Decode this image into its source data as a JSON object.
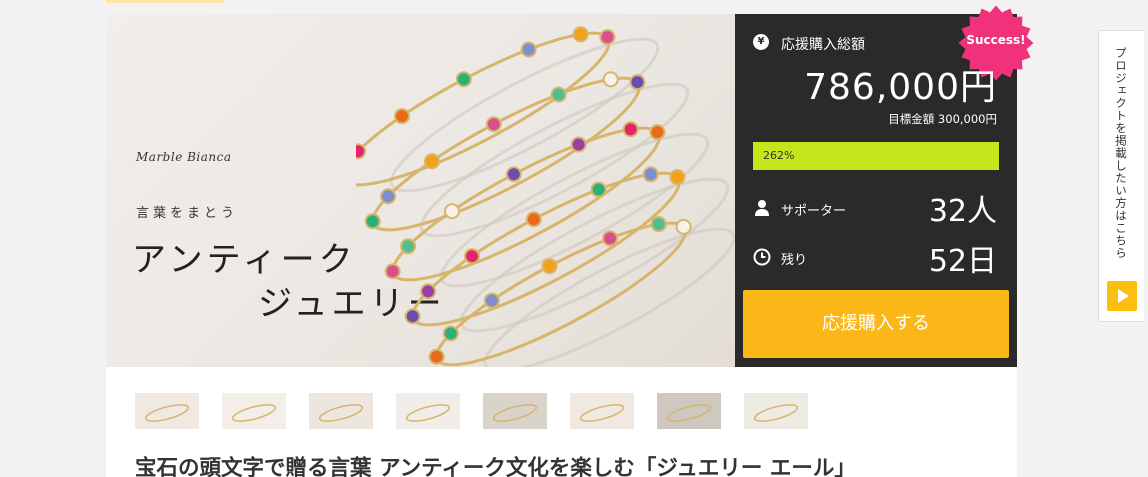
{
  "hero": {
    "brand": "Marble Bianca",
    "tagline": "言葉をまとう",
    "headline_line1": "アンティーク",
    "headline_line2": "ジュエリー"
  },
  "stats": {
    "total_label": "応援購入総額",
    "total_amount": "786,000円",
    "success_badge": "Success!",
    "target_label": "目標金額 300,000円",
    "progress_text": "262%",
    "progress_fill_fraction": 1.0,
    "supporters_label": "サポーター",
    "supporters_value": "32人",
    "remaining_label": "残り",
    "remaining_value": "52日",
    "cta_label": "応援購入する"
  },
  "colors": {
    "panel_bg": "#2a2a2a",
    "progress": "#c6e61c",
    "cta": "#fbb718",
    "success": "#f0327a",
    "side_button": "#fbbf10"
  },
  "icons": {
    "yen": "yen-icon",
    "person": "person-icon",
    "clock": "clock-icon",
    "play": "play-icon",
    "yen_glyph": "¥"
  },
  "thumbnails_count": 8,
  "project_title": "宝石の頭文字で贈る言葉 アンティーク文化を楽しむ「ジュエリー エール」",
  "side_tab": {
    "label": "プロジェクトを掲載したい方はこちら"
  }
}
